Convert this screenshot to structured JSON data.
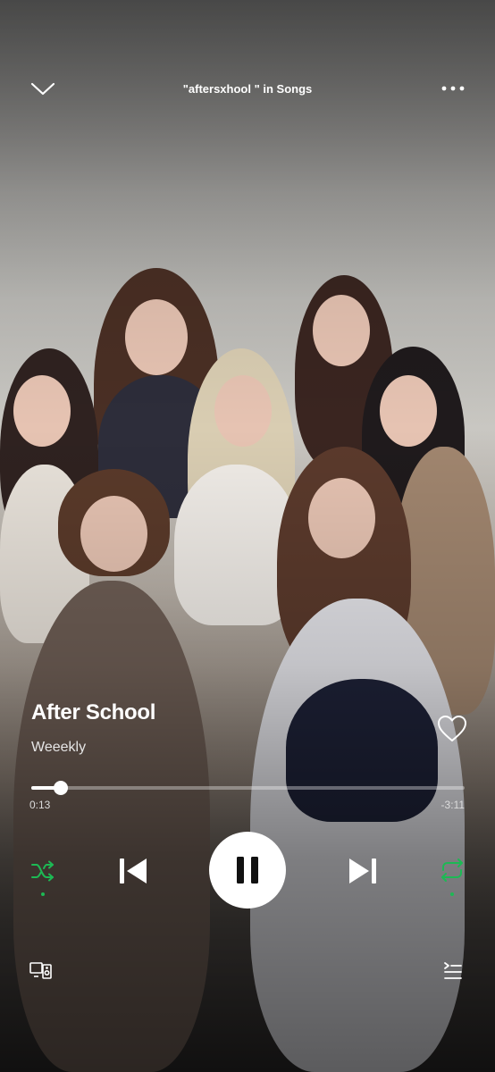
{
  "header": {
    "context_title": "\"aftersxhool \" in Songs"
  },
  "track": {
    "title": "After School",
    "artist": "Weeekly",
    "liked": false
  },
  "playback": {
    "elapsed": "0:13",
    "remaining": "-3:11",
    "progress_fraction": 0.069,
    "shuffle_on": true,
    "repeat_on": true,
    "is_playing": true
  },
  "colors": {
    "accent": "#1db954",
    "text": "#ffffff"
  },
  "icons": {
    "collapse": "chevron-down-icon",
    "menu": "more-icon",
    "like": "heart-icon",
    "shuffle": "shuffle-icon",
    "previous": "skip-previous-icon",
    "pause": "pause-icon",
    "next": "skip-next-icon",
    "repeat": "repeat-icon",
    "devices": "devices-icon",
    "queue": "queue-icon"
  }
}
